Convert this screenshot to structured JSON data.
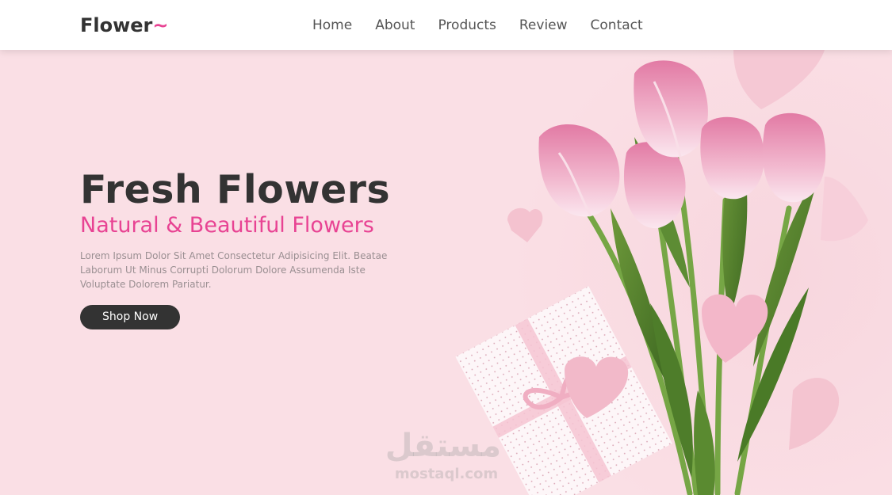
{
  "header": {
    "logo_text": "Flower",
    "logo_mark": "~",
    "nav": [
      "Home",
      "About",
      "Products",
      "Review",
      "Contact"
    ]
  },
  "hero": {
    "title": "Fresh Flowers",
    "subtitle": "Natural & Beautiful Flowers",
    "description": "Lorem Ipsum Dolor Sit Amet Consectetur Adipisicing Elit. Beatae Laborum Ut Minus Corrupti Dolorum Dolore Assumenda Iste Voluptate Dolorem Pariatur.",
    "button_label": "Shop Now"
  },
  "watermark": {
    "arabic": "مستقل",
    "latin": "mostaql.com"
  },
  "colors": {
    "accent": "#e84393",
    "dark": "#333333",
    "hero_bg": "#fadfe5"
  },
  "icons": {
    "hero_image": "pink-tulip-bouquet-with-gift-box-and-paper-hearts"
  }
}
